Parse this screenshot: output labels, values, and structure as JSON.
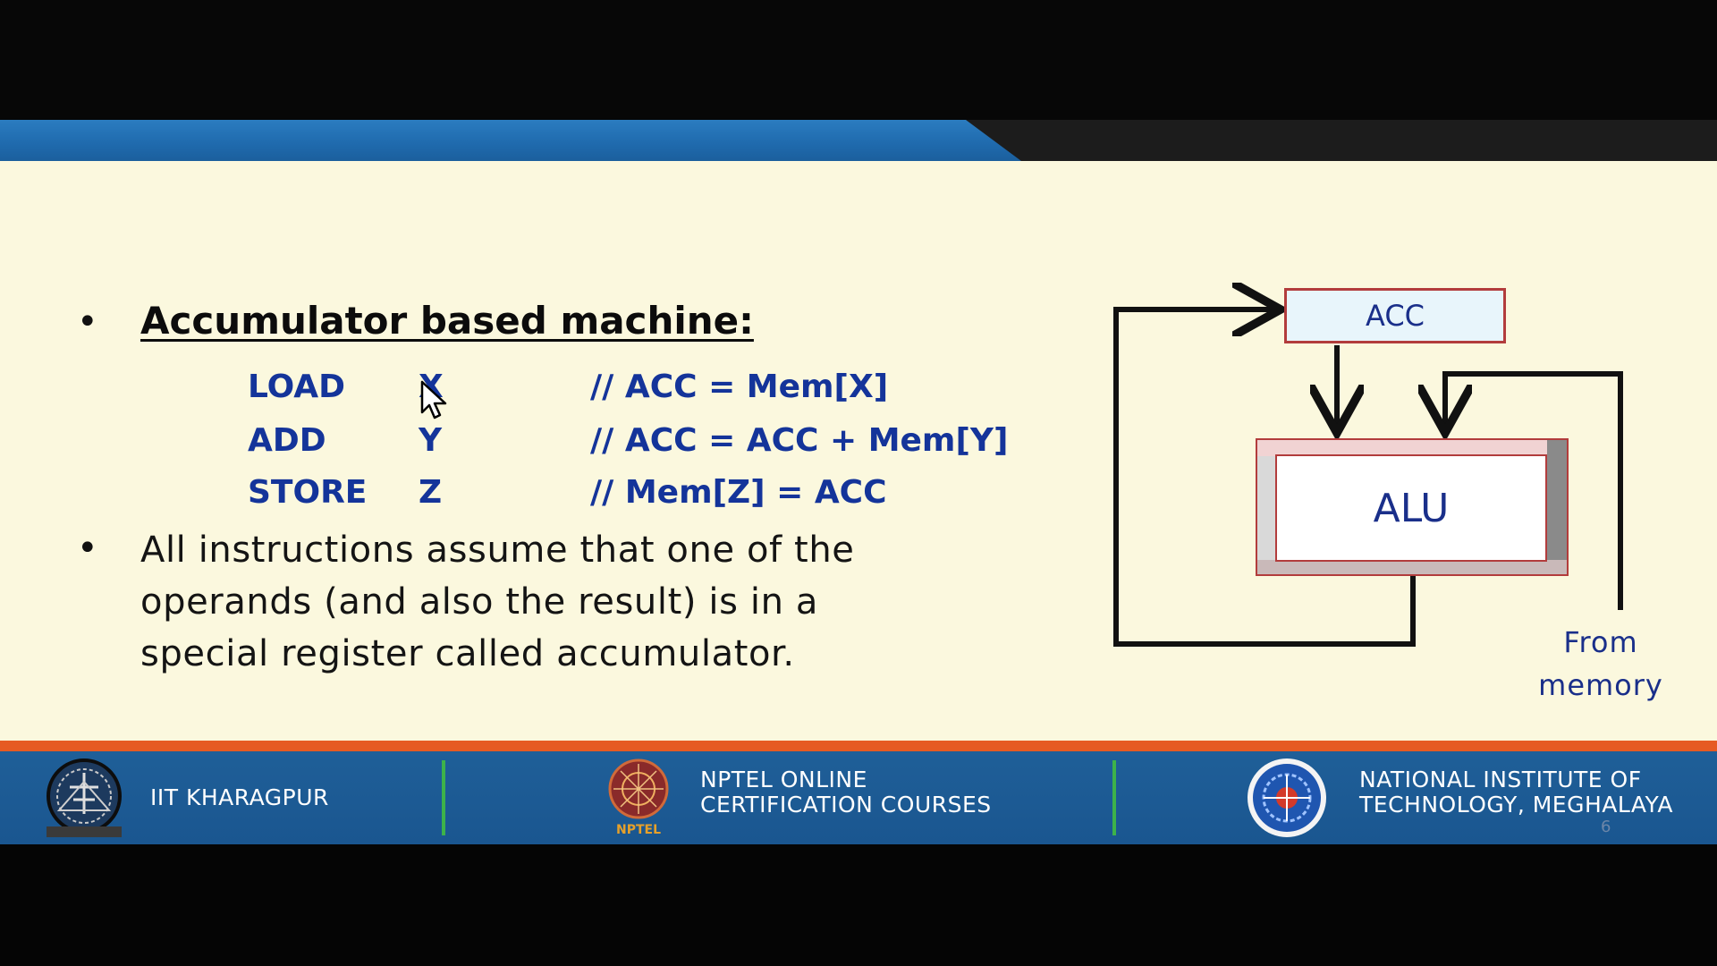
{
  "slide": {
    "heading": "Accumulator based machine:",
    "code": [
      {
        "op": "LOAD",
        "arg": "X",
        "comment": "//  ACC = Mem[X]"
      },
      {
        "op": "ADD",
        "arg": "Y",
        "comment": "// ACC = ACC + Mem[Y]"
      },
      {
        "op": "STORE",
        "arg": "Z",
        "comment": "// Mem[Z] = ACC"
      }
    ],
    "description_lines": [
      "All instructions assume that one of the",
      "operands (and also the result) is in a",
      "special register called accumulator."
    ],
    "bullet_glyph": "•"
  },
  "diagram": {
    "acc_label": "ACC",
    "alu_label": "ALU",
    "from_memory_lines": [
      "From",
      "memory"
    ]
  },
  "footer": {
    "left_label": "IIT KHARAGPUR",
    "center_lines": [
      "NPTEL ONLINE",
      "CERTIFICATION COURSES"
    ],
    "center_logo_text": "NPTEL",
    "right_lines": [
      "NATIONAL INSTITUTE OF",
      "TECHNOLOGY, MEGHALAYA"
    ],
    "slide_number": "6"
  },
  "colors": {
    "header_blue": "#1f6aad",
    "slide_background": "#fbf8de",
    "code_blue": "#14349a",
    "footer_blue": "#1a5690",
    "footer_orange": "#e65a23",
    "divider_green": "#3db24a",
    "box_border_red": "#b23c3c"
  },
  "icons": {
    "left_logo": "iit-kharagpur-emblem-icon",
    "center_logo": "nptel-logo-icon",
    "right_logo": "nit-meghalaya-emblem-icon",
    "cursor": "mouse-pointer-icon"
  }
}
